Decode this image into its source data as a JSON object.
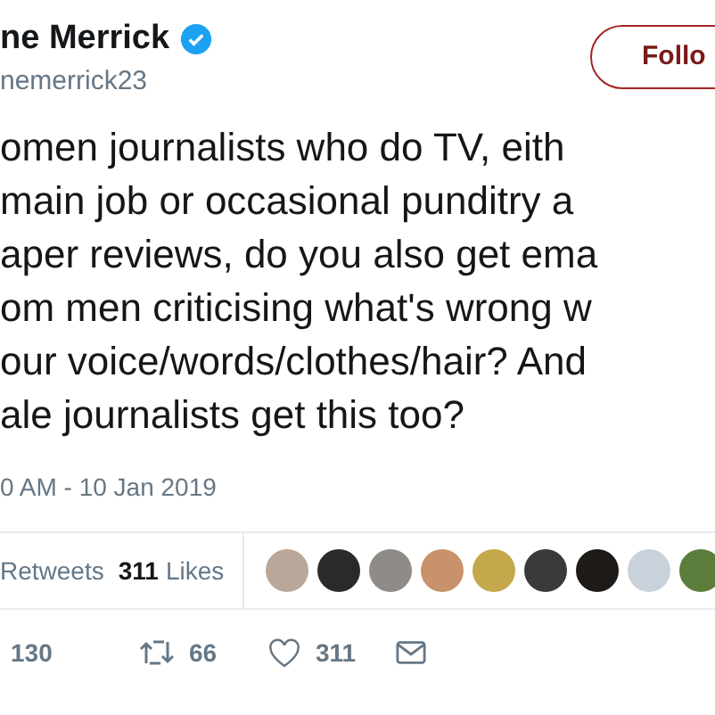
{
  "author": {
    "name": "ne Merrick",
    "handle": "nemerrick23",
    "verified": true
  },
  "follow_button": "Follo",
  "tweet_lines": [
    "omen journalists who do TV, eith",
    "main job or occasional punditry a",
    "aper reviews, do you also get ema",
    "om men criticising what's wrong w",
    "our voice/words/clothes/hair? And",
    "ale journalists get this too?"
  ],
  "timestamp": "0 AM - 10 Jan 2019",
  "stats": {
    "retweets_label": "Retweets",
    "likes_count": "311",
    "likes_label": "Likes"
  },
  "likers": [
    {
      "color": "#b9a89a"
    },
    {
      "color": "#2a2a2a"
    },
    {
      "color": "#8f8b86"
    },
    {
      "color": "#c8926a"
    },
    {
      "color": "#c4a84c"
    },
    {
      "color": "#3a3a3a"
    },
    {
      "color": "#1e1a18"
    },
    {
      "color": "#c9d2db"
    },
    {
      "color": "#5d7d3c"
    }
  ],
  "actions": [
    {
      "kind": "reply",
      "count": "130"
    },
    {
      "kind": "retweet",
      "count": "66"
    },
    {
      "kind": "like",
      "count": "311"
    },
    {
      "kind": "message"
    }
  ]
}
